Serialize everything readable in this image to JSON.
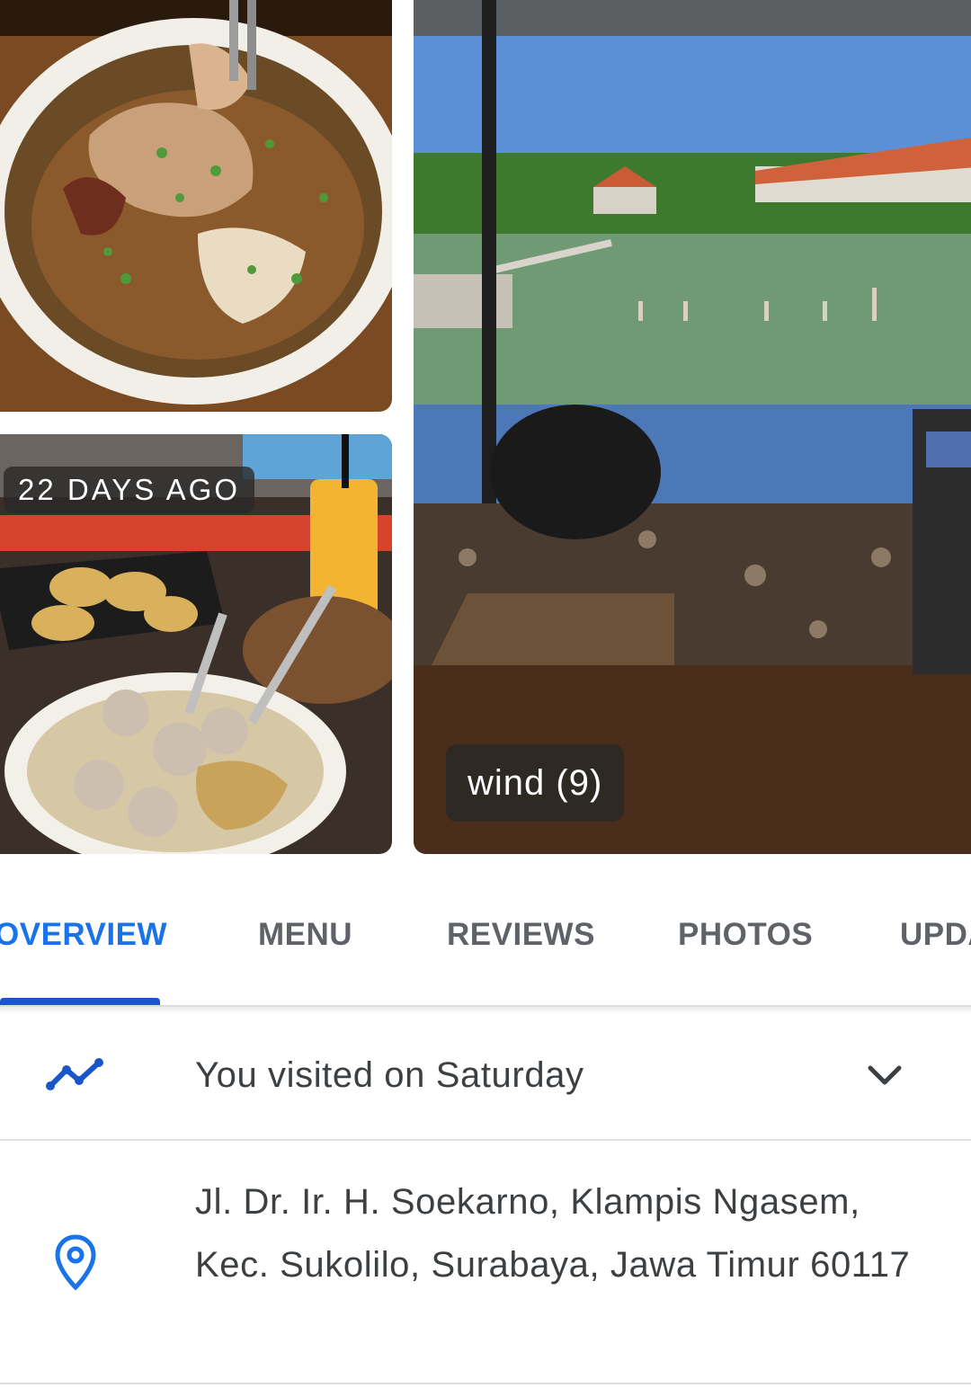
{
  "gallery": {
    "photos": [
      {
        "subject": "soup-bowl-photo"
      },
      {
        "subject": "meatball-soup-photo",
        "badge": "22 DAYS AGO"
      },
      {
        "subject": "pond-view-photo",
        "badge": "wind (9)"
      }
    ]
  },
  "tabs": [
    {
      "label": "OVERVIEW",
      "active": true
    },
    {
      "label": "MENU",
      "active": false
    },
    {
      "label": "REVIEWS",
      "active": false
    },
    {
      "label": "PHOTOS",
      "active": false
    },
    {
      "label": "UPDA",
      "active": false
    }
  ],
  "visit": {
    "icon": "timeline-icon",
    "text": "You visited on Saturday",
    "expand_icon": "chevron-down-icon"
  },
  "address": {
    "icon": "location-pin-icon",
    "text": "Jl. Dr. Ir. H. Soekarno, Klampis Ngasem, Kec. Sukolilo, Surabaya, Jawa Timur 60117"
  },
  "colors": {
    "accent": "#1a73e8",
    "tab_inactive": "#5f6368",
    "text_primary": "#3c4043",
    "divider": "#e0e0e0"
  }
}
